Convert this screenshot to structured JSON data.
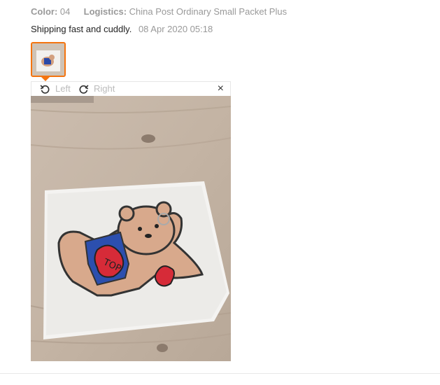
{
  "meta": {
    "color_label": "Color:",
    "color_value": "04",
    "logistics_label": "Logistics:",
    "logistics_value": "China Post Ordinary Small Packet Plus"
  },
  "review": {
    "text": "Shipping fast and cuddly.",
    "date": "08 Apr 2020 05:18"
  },
  "viewer": {
    "rotate_left_label": "Left",
    "rotate_right_label": "Right",
    "close_symbol": "×"
  },
  "colors": {
    "accent": "#f4740f",
    "muted_text": "#999999"
  },
  "icons": [
    "rotate-left-icon",
    "rotate-right-icon",
    "close-icon"
  ]
}
